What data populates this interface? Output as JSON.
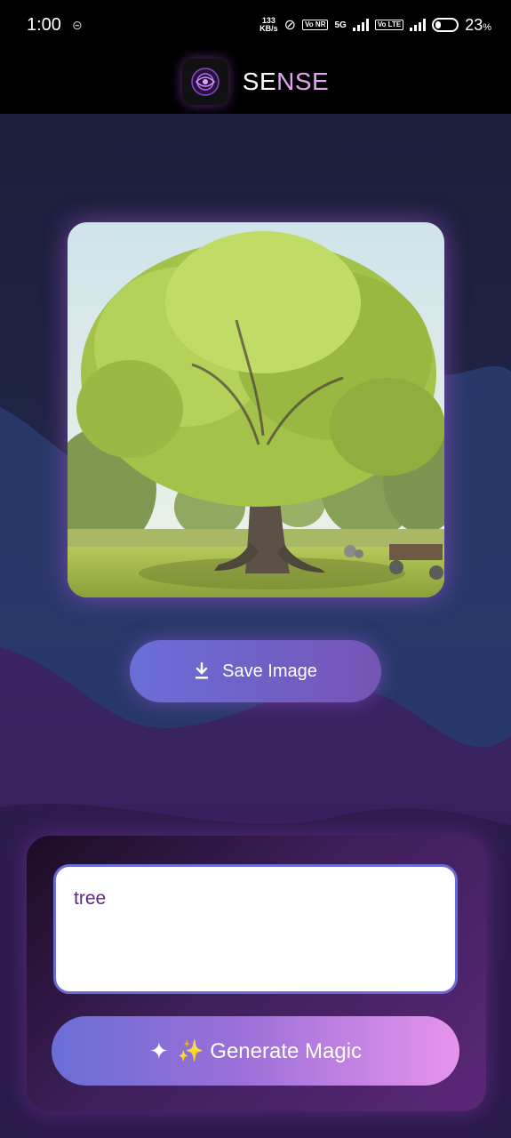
{
  "status_bar": {
    "time": "1:00",
    "speed_value": "133",
    "speed_unit": "KB/s",
    "volte1": "Vo NR",
    "network": "5G",
    "volte2": "Vo LTE",
    "battery_percent": "23",
    "percent_sign": "%"
  },
  "header": {
    "title_part1": "SE",
    "title_part2": "NSE"
  },
  "image": {
    "subject": "tree"
  },
  "actions": {
    "save_label": "Save Image",
    "generate_label": "✨ Generate Magic"
  },
  "prompt": {
    "value": "tree"
  },
  "colors": {
    "accent_purple": "#e3a3f3",
    "button_start": "#6a6ed6",
    "button_end": "#e694ec"
  }
}
